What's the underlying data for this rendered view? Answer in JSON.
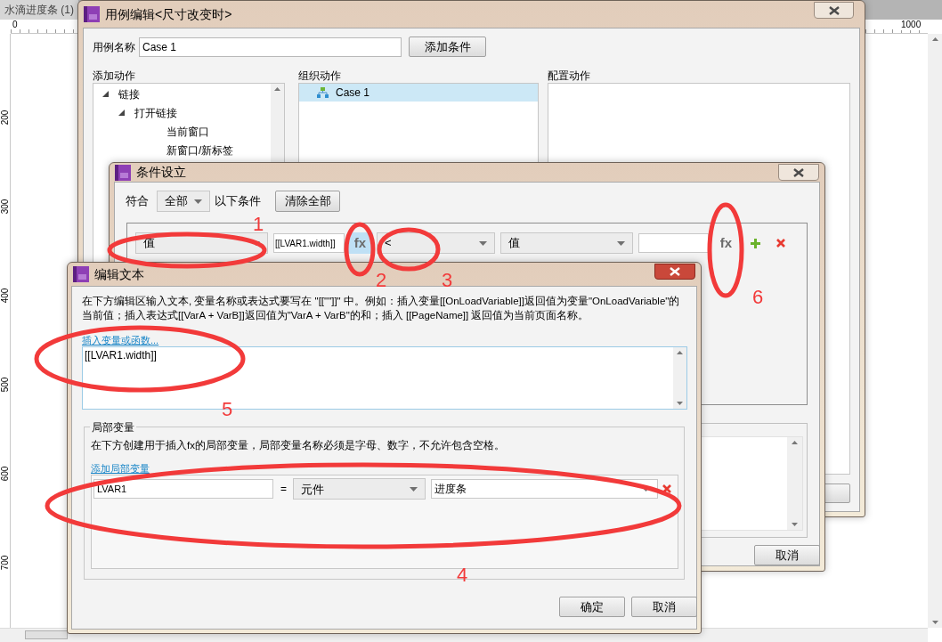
{
  "canvas": {
    "tab": "水滴进度条 (1)",
    "ruler_labels": [
      "0",
      "1000"
    ],
    "vertical_ruler_labels": [
      "200",
      "300",
      "400",
      "500",
      "600",
      "700"
    ]
  },
  "case_editor": {
    "title": "用例编辑<尺寸改变时>",
    "case_name_label": "用例名称",
    "case_name": "Case 1",
    "add_condition_button": "添加条件",
    "add_actions_label": "添加动作",
    "organize_label": "组织动作",
    "configure_label": "配置动作",
    "action_tree": [
      {
        "label": "链接",
        "expanded": true,
        "children": [
          {
            "label": "打开链接",
            "expanded": true,
            "children": [
              {
                "label": "当前窗口"
              },
              {
                "label": "新窗口/新标签"
              }
            ]
          }
        ]
      }
    ],
    "organize_items": [
      {
        "label": "Case 1",
        "selected": true
      }
    ]
  },
  "condition_dialog": {
    "title": "条件设立",
    "match_label": "符合",
    "match_value": "全部",
    "match_suffix": "以下条件",
    "clear_all_button": "清除全部",
    "conditions": [
      {
        "subject": "值",
        "value": "[[LVAR1.width]]",
        "value_fx": {
          "label": "fx",
          "highlighted": true
        },
        "operator": "<",
        "target": "值",
        "target_fx": {
          "label": "fx",
          "highlighted": false
        }
      }
    ],
    "buttons": [
      "取消"
    ]
  },
  "edit_text_dialog": {
    "title": "编辑文本",
    "description": "在下方编辑区输入文本, 变量名称或表达式要写在 \"[[\"\"]]\" 中。例如：插入变量[[OnLoadVariable]]返回值为变量\"OnLoadVariable\"的当前值；插入表达式[[VarA + VarB]]返回值为\"VarA + VarB\"的和；插入 [[PageName]] 返回值为当前页面名称。",
    "insert_link": "插入变量或函数...",
    "text_value": "[[LVAR1.width]]",
    "local_variables": {
      "legend": "局部变量",
      "hint": "在下方创建用于插入fx的局部变量，局部变量名称必须是字母、数字，不允许包含空格。",
      "add_link": "添加局部变量",
      "rows": [
        {
          "name": "LVAR1",
          "equals": "=",
          "type": "元件",
          "target": "进度条"
        }
      ]
    },
    "buttons": [
      "确定",
      "取消"
    ]
  },
  "annotations": [
    {
      "label": "1"
    },
    {
      "label": "2"
    },
    {
      "label": "3"
    },
    {
      "label": "4"
    },
    {
      "label": "5"
    },
    {
      "label": "6"
    }
  ]
}
